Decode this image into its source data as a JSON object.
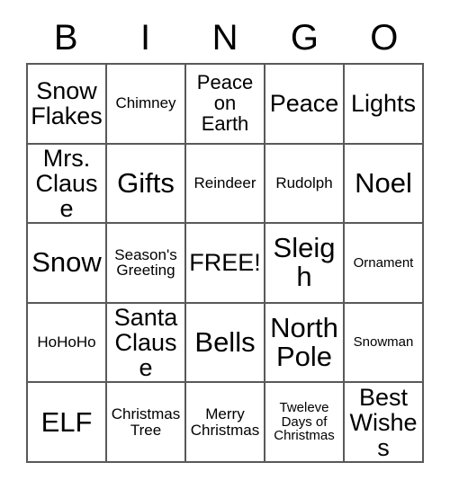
{
  "card": {
    "headers": [
      "B",
      "I",
      "N",
      "G",
      "O"
    ],
    "rows": [
      [
        {
          "text": "Snow\nFlakes",
          "size": "fs-lg"
        },
        {
          "text": "Chimney",
          "size": "fs-sm"
        },
        {
          "text": "Peace\non\nEarth",
          "size": "fs-md"
        },
        {
          "text": "Peace",
          "size": "fs-lg"
        },
        {
          "text": "Lights",
          "size": "fs-lg"
        }
      ],
      [
        {
          "text": "Mrs.\nClause",
          "size": "fs-lg"
        },
        {
          "text": "Gifts",
          "size": "fs-xl"
        },
        {
          "text": "Reindeer",
          "size": "fs-sm"
        },
        {
          "text": "Rudolph",
          "size": "fs-sm"
        },
        {
          "text": "Noel",
          "size": "fs-xl"
        }
      ],
      [
        {
          "text": "Snow",
          "size": "fs-xl"
        },
        {
          "text": "Season's\nGreeting",
          "size": "fs-sm"
        },
        {
          "text": "FREE!",
          "size": "fs-lg"
        },
        {
          "text": "Sleigh",
          "size": "fs-xl"
        },
        {
          "text": "Ornament",
          "size": "fs-xs"
        }
      ],
      [
        {
          "text": "HoHoHo",
          "size": "fs-sm"
        },
        {
          "text": "Santa\nClause",
          "size": "fs-lg"
        },
        {
          "text": "Bells",
          "size": "fs-xl"
        },
        {
          "text": "North\nPole",
          "size": "fs-xl"
        },
        {
          "text": "Snowman",
          "size": "fs-xs"
        }
      ],
      [
        {
          "text": "ELF",
          "size": "fs-xl"
        },
        {
          "text": "Christmas\nTree",
          "size": "fs-sm"
        },
        {
          "text": "Merry\nChristmas",
          "size": "fs-sm"
        },
        {
          "text": "Tweleve\nDays of\nChristmas",
          "size": "fs-xs"
        },
        {
          "text": "Best\nWishes",
          "size": "fs-lg"
        }
      ]
    ],
    "colors": {
      "border": "#595959",
      "text": "#000000",
      "background": "#ffffff"
    }
  }
}
